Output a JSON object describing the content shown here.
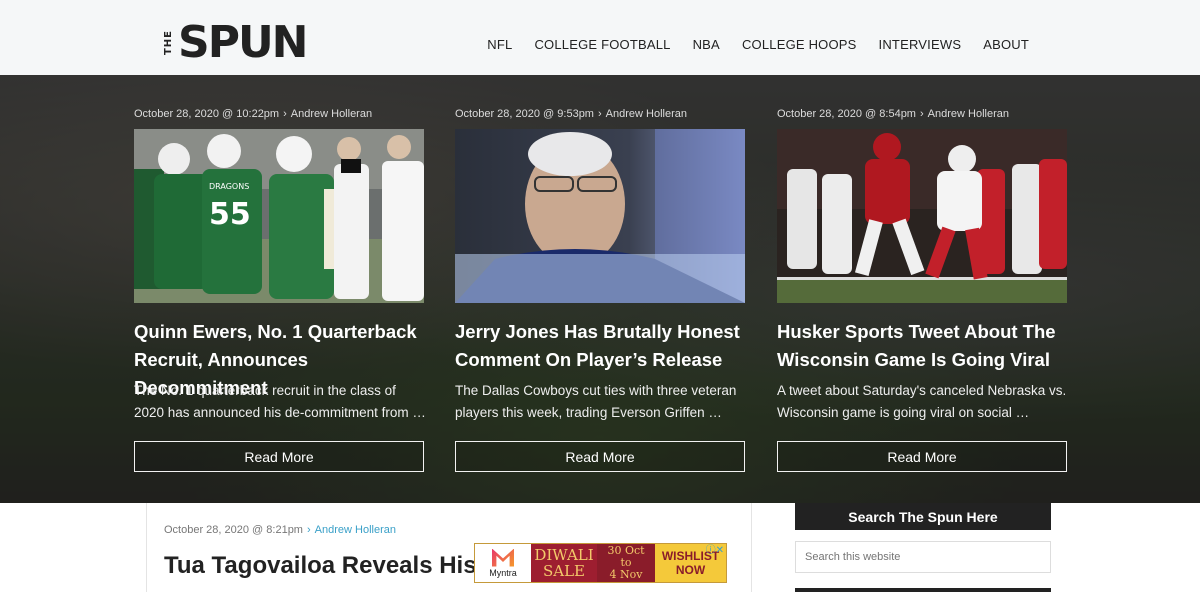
{
  "logo": {
    "small": "THE",
    "big": "SPUN"
  },
  "nav": [
    "NFL",
    "COLLEGE FOOTBALL",
    "NBA",
    "COLLEGE HOOPS",
    "INTERVIEWS",
    "ABOUT"
  ],
  "featured": [
    {
      "date": "October 28, 2020 @ 10:22pm",
      "author": "Andrew Holleran",
      "title": "Quinn Ewers, No. 1 Quarterback Recruit, Announces Decommitment",
      "excerpt": "The No. 1 quarterback recruit in the class of 2020 has announced his de-commitment from …",
      "button": "Read More"
    },
    {
      "date": "October 28, 2020 @ 9:53pm",
      "author": "Andrew Holleran",
      "title": "Jerry Jones Has Brutally Honest Comment On Player’s Release",
      "excerpt": "The Dallas Cowboys cut ties with three veteran players this week, trading Everson Griffen …",
      "button": "Read More"
    },
    {
      "date": "October 28, 2020 @ 8:54pm",
      "author": "Andrew Holleran",
      "title": "Husker Sports Tweet About The Wisconsin Game Is Going Viral",
      "excerpt": "A tweet about Saturday's canceled Nebraska vs. Wisconsin game is going viral on social …",
      "button": "Read More"
    }
  ],
  "jersey_text": {
    "team": "DRAGONS",
    "number": "55"
  },
  "main_post": {
    "date": "October 28, 2020 @ 8:21pm",
    "author": "Andrew Holleran",
    "title": "Tua Tagovailoa Reveals His Le"
  },
  "ad": {
    "brand": "Myntra",
    "line1": "DIWALI",
    "line2": "SALE",
    "date_line1": "30 Oct",
    "date_line2": "to",
    "date_line3": "4 Nov",
    "cta1": "WISHLIST",
    "cta2": "NOW"
  },
  "sidebar": {
    "search_title": "Search The Spun Here",
    "search_placeholder": "Search this website"
  },
  "separator": "›"
}
